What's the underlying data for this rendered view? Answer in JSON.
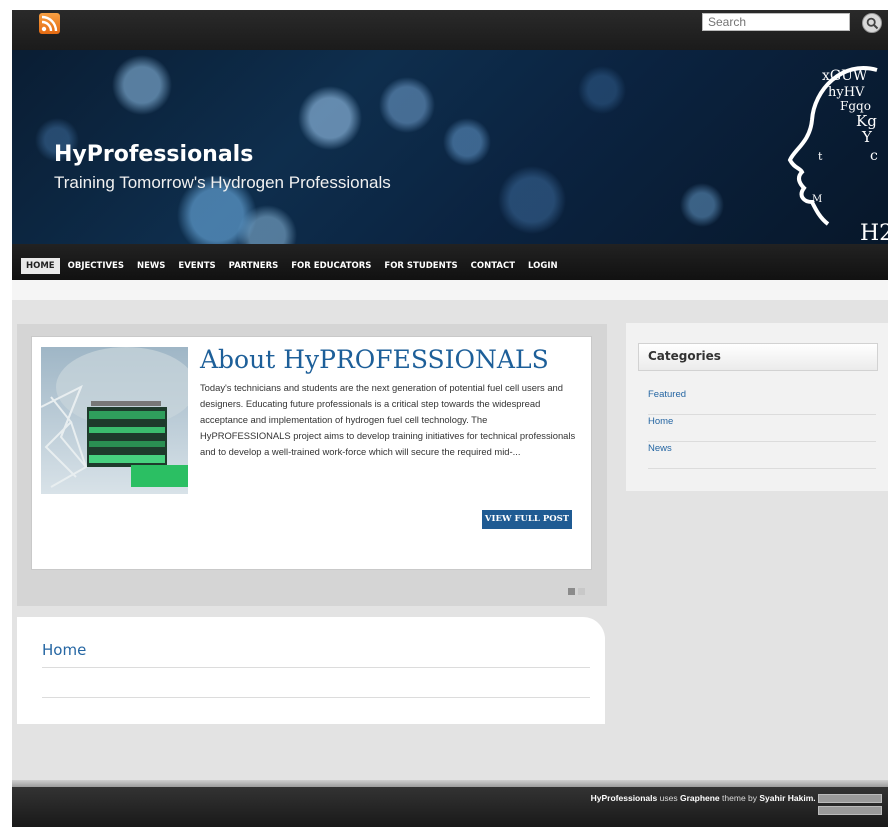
{
  "topbar": {
    "search_placeholder": "Search",
    "icons": [
      "rss-icon",
      "search-icon"
    ]
  },
  "header": {
    "site_title": "HyProfessionals",
    "tagline": "Training Tomorrow's Hydrogen Professionals",
    "logo_text": "H2"
  },
  "nav": {
    "items": [
      {
        "label": "HOME",
        "active": true
      },
      {
        "label": "OBJECTIVES",
        "active": false
      },
      {
        "label": "NEWS",
        "active": false
      },
      {
        "label": "EVENTS",
        "active": false
      },
      {
        "label": "PARTNERS",
        "active": false
      },
      {
        "label": "FOR EDUCATORS",
        "active": false
      },
      {
        "label": "FOR STUDENTS",
        "active": false
      },
      {
        "label": "CONTACT",
        "active": false
      },
      {
        "label": "LOGIN",
        "active": false
      }
    ]
  },
  "featured": {
    "title": "About HyPROFESSIONALS",
    "excerpt": "Today's technicians and students are the next generation of potential fuel cell users and designers. Educating future professionals is a critical step towards the widespread acceptance and implementation of hydrogen fuel cell technology. The HyPROFESSIONALS project aims to develop training initiatives for technical professionals and to develop a well-trained work-force which will secure the required mid-...",
    "button_label": "VIEW FULL POST",
    "slide_count": 2,
    "active_slide": 1
  },
  "home_panel": {
    "title": "Home"
  },
  "sidebar": {
    "categories_title": "Categories",
    "categories": [
      "Featured",
      "Home",
      "News"
    ]
  },
  "footer": {
    "site_name": "HyProfessionals",
    "uses": "uses",
    "theme_name": "Graphene",
    "theme_by": "theme by",
    "author": "Syahir Hakim."
  },
  "colors": {
    "link_blue": "#2566a3",
    "button_blue": "#1f5b93",
    "topbar": "#1b1b1b",
    "rss_orange": "#e46a12"
  }
}
